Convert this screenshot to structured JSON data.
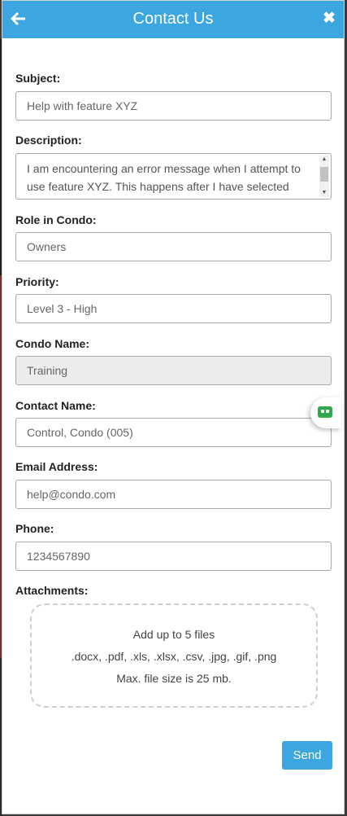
{
  "header": {
    "title": "Contact Us",
    "back_icon": "arrow-left-icon",
    "close_icon": "close-icon",
    "color": "#3ba6df"
  },
  "form": {
    "subject": {
      "label": "Subject:",
      "value": "Help with feature XYZ"
    },
    "description": {
      "label": "Description:",
      "value": "I am encountering an error message when I attempt to use feature XYZ.  This happens after I have selected the..."
    },
    "role": {
      "label": "Role in Condo:",
      "value": "Owners"
    },
    "priority": {
      "label": "Priority:",
      "value": "Level 3 - High"
    },
    "condo_name": {
      "label": "Condo Name:",
      "value": "Training"
    },
    "contact_name": {
      "label": "Contact Name:",
      "value": "Control, Condo (005)"
    },
    "email": {
      "label": "Email Address:",
      "value": "help@condo.com"
    },
    "phone": {
      "label": "Phone:",
      "value": "1234567890"
    },
    "attachments": {
      "label": "Attachments:",
      "line1": "Add up to 5 files",
      "line2": ".docx, .pdf, .xls, .xlsx, .csv, .jpg, .gif, .png",
      "line3": "Max. file size is 25 mb."
    }
  },
  "actions": {
    "send_label": "Send"
  },
  "chat_widget": {
    "icon": "chat-bot-icon",
    "color": "#2fa84f"
  }
}
